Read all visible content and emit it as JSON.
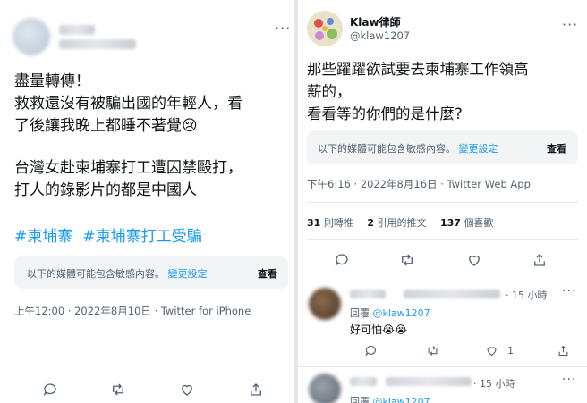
{
  "left": {
    "timestamp": "上午12:00 · 2022年8月10日 · Twitter for iPhone",
    "line1": "盡量轉傳！",
    "line2": "救救還沒有被騙出國的年輕人，看",
    "line3": "了後讓我晚上都睡不著覺😢",
    "line4": "台灣女赴柬埔寨打工遭囚禁毆打，",
    "line5": "打人的錄影片的都是中國人",
    "hashtag1": "#柬埔寨",
    "hashtag2": "#柬埔寨打工受騙",
    "sensitive_text": "以下的媒體可能包含敏感內容。",
    "sensitive_link": "變更設定",
    "sensitive_view": "查看",
    "more": "···"
  },
  "right": {
    "name": "Klaw律師",
    "handle": "@klaw1207",
    "more": "···",
    "line1": "那些躍躍欲試要去柬埔寨工作領高",
    "line2": "薪的，",
    "line3": "看看等的你們的是什麼?",
    "sensitive_text": "以下的媒體可能包含敏感內容。",
    "sensitive_link": "變更設定",
    "sensitive_view": "查看",
    "timestamp": "下午6:16 · 2022年8月16日 · Twitter Web App",
    "retweets_num": "31",
    "retweets_label": "則轉推",
    "quotes_num": "2",
    "quotes_label": "引用的推文",
    "likes_num": "137",
    "likes_label": "個喜歡",
    "reply1": {
      "time": "· 15 小時",
      "reply_prefix": "回覆",
      "reply_handle": "@klaw1207",
      "text": "好可怕😭😭",
      "like_count": "1",
      "more": "···"
    },
    "reply2": {
      "time": "· 15 小時",
      "reply_prefix": "回覆",
      "reply_handle": "@klaw1207",
      "more": "···"
    }
  },
  "colors": {
    "accent": "#1d9bf0",
    "text": "#0f1419",
    "muted": "#536471"
  }
}
